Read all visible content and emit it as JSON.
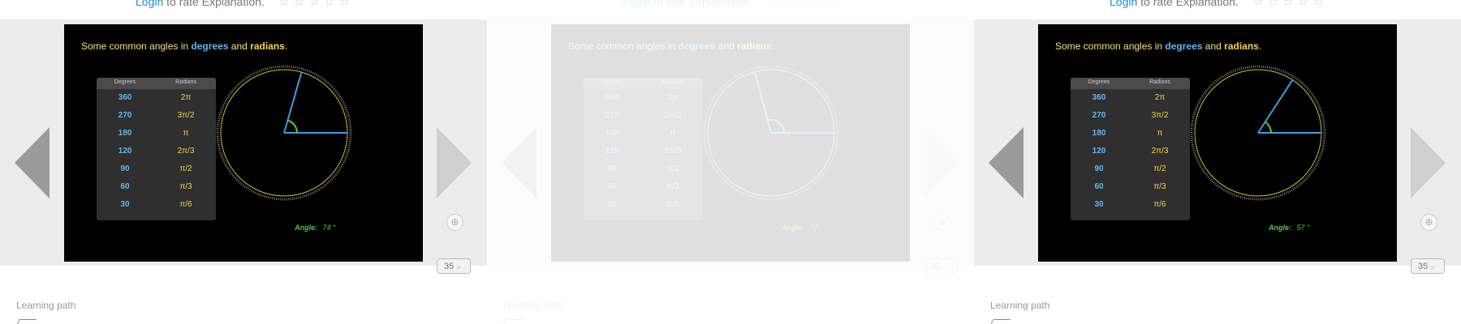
{
  "login_prompt": {
    "link": "Login",
    "rest": "to rate Explanation."
  },
  "stars": "☆☆☆☆☆",
  "slide": {
    "heading": {
      "prefix": "Some common angles in",
      "degrees": "degrees",
      "and": "and",
      "radians": "radians",
      "period": "."
    },
    "table": {
      "headers": {
        "degrees": "Degrees",
        "radians": "Radians"
      },
      "rows": [
        {
          "deg": "360",
          "rad": "2π"
        },
        {
          "deg": "270",
          "rad": "3π/2"
        },
        {
          "deg": "180",
          "rad": "π"
        },
        {
          "deg": "120",
          "rad": "2π/3"
        },
        {
          "deg": "90",
          "rad": "π/2"
        },
        {
          "deg": "60",
          "rad": "π/3"
        },
        {
          "deg": "30",
          "rad": "π/6"
        }
      ]
    },
    "angle_label": "Angle:"
  },
  "panels": [
    {
      "angle_value": "74 °",
      "angle_deg": 74,
      "dimmed": false
    },
    {
      "angle_value": "??",
      "angle_deg": 105,
      "dimmed": true
    },
    {
      "angle_value": "57 °",
      "angle_deg": 57,
      "dimmed": false
    }
  ],
  "counter": {
    "value": "35",
    "tiny": "##"
  },
  "plus_icon": "⊕",
  "learning_path": "Learning path",
  "colors": {
    "link": "#1a8fd8",
    "degrees": "#62b6f0",
    "radians": "#f5d24a",
    "angle": "#5bc43b",
    "slide_bg": "#000000"
  }
}
